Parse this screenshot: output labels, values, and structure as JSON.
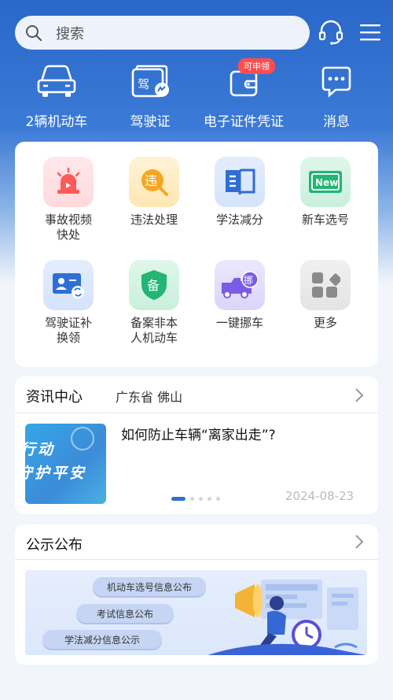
{
  "search": {
    "placeholder": "搜索"
  },
  "header": {
    "support_icon": "headset-icon",
    "menu_icon": "menu-icon"
  },
  "quick_actions": [
    {
      "label": "2辆机动车",
      "icon": "car-icon"
    },
    {
      "label": "驾驶证",
      "icon": "license-card-icon"
    },
    {
      "label": "电子证件凭证",
      "icon": "wallet-icon",
      "badge": "可申领"
    },
    {
      "label": "消息",
      "icon": "message-icon"
    }
  ],
  "services": [
    {
      "label": "事故视频快处",
      "icon": "siren-icon",
      "color": "#ff5a5a"
    },
    {
      "label": "违法处理",
      "icon": "violation-search-icon",
      "color": "#f5a623"
    },
    {
      "label": "学法减分",
      "icon": "book-icon",
      "color": "#2f6fd3"
    },
    {
      "label": "新车选号",
      "icon": "new-plate-icon",
      "color": "#22b573"
    },
    {
      "label": "驾驶证补换领",
      "icon": "id-card-swap-icon",
      "color": "#2f6fd3"
    },
    {
      "label": "备案非本人机动车",
      "icon": "record-shield-icon",
      "color": "#22b573"
    },
    {
      "label": "一键挪车",
      "icon": "truck-move-icon",
      "color": "#7b5ce6"
    },
    {
      "label": "更多",
      "icon": "grid-more-icon",
      "color": "#888888"
    }
  ],
  "news": {
    "title": "资讯中心",
    "location": "广东省 佛山",
    "article_title": "如何防止车辆“离家出走”?",
    "date": "2024-08-23",
    "thumb_text_1": "行动",
    "thumb_text_2": "守护平安",
    "carousel_count": 5,
    "carousel_active": 1
  },
  "notices": {
    "title": "公示公布",
    "items": [
      "机动车选号信息公布",
      "考试信息公布",
      "学法减分信息公示"
    ]
  },
  "colors": {
    "primary": "#2f6fd3",
    "background": "#f2f5f9",
    "badge": "#ff4d4f"
  }
}
